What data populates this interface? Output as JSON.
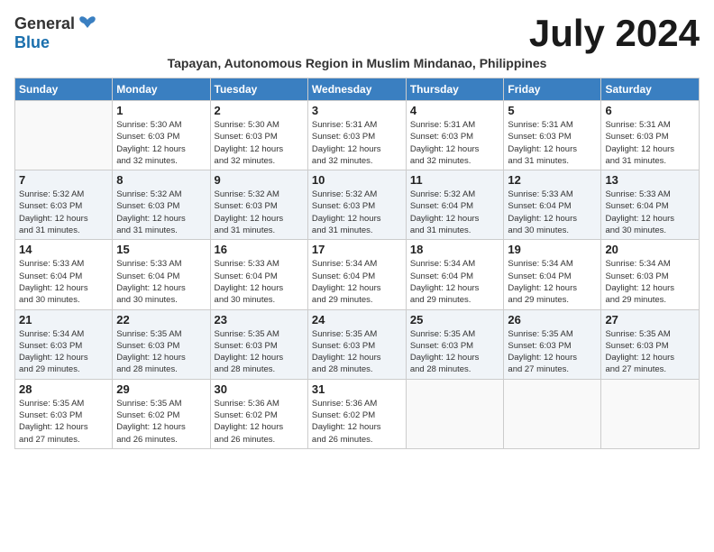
{
  "logo": {
    "general": "General",
    "blue": "Blue"
  },
  "title": "July 2024",
  "subtitle": "Tapayan, Autonomous Region in Muslim Mindanao, Philippines",
  "days_of_week": [
    "Sunday",
    "Monday",
    "Tuesday",
    "Wednesday",
    "Thursday",
    "Friday",
    "Saturday"
  ],
  "weeks": [
    [
      {
        "date": "",
        "info": ""
      },
      {
        "date": "1",
        "info": "Sunrise: 5:30 AM\nSunset: 6:03 PM\nDaylight: 12 hours\nand 32 minutes."
      },
      {
        "date": "2",
        "info": "Sunrise: 5:30 AM\nSunset: 6:03 PM\nDaylight: 12 hours\nand 32 minutes."
      },
      {
        "date": "3",
        "info": "Sunrise: 5:31 AM\nSunset: 6:03 PM\nDaylight: 12 hours\nand 32 minutes."
      },
      {
        "date": "4",
        "info": "Sunrise: 5:31 AM\nSunset: 6:03 PM\nDaylight: 12 hours\nand 32 minutes."
      },
      {
        "date": "5",
        "info": "Sunrise: 5:31 AM\nSunset: 6:03 PM\nDaylight: 12 hours\nand 31 minutes."
      },
      {
        "date": "6",
        "info": "Sunrise: 5:31 AM\nSunset: 6:03 PM\nDaylight: 12 hours\nand 31 minutes."
      }
    ],
    [
      {
        "date": "7",
        "info": "Sunrise: 5:32 AM\nSunset: 6:03 PM\nDaylight: 12 hours\nand 31 minutes."
      },
      {
        "date": "8",
        "info": "Sunrise: 5:32 AM\nSunset: 6:03 PM\nDaylight: 12 hours\nand 31 minutes."
      },
      {
        "date": "9",
        "info": "Sunrise: 5:32 AM\nSunset: 6:03 PM\nDaylight: 12 hours\nand 31 minutes."
      },
      {
        "date": "10",
        "info": "Sunrise: 5:32 AM\nSunset: 6:03 PM\nDaylight: 12 hours\nand 31 minutes."
      },
      {
        "date": "11",
        "info": "Sunrise: 5:32 AM\nSunset: 6:04 PM\nDaylight: 12 hours\nand 31 minutes."
      },
      {
        "date": "12",
        "info": "Sunrise: 5:33 AM\nSunset: 6:04 PM\nDaylight: 12 hours\nand 30 minutes."
      },
      {
        "date": "13",
        "info": "Sunrise: 5:33 AM\nSunset: 6:04 PM\nDaylight: 12 hours\nand 30 minutes."
      }
    ],
    [
      {
        "date": "14",
        "info": "Sunrise: 5:33 AM\nSunset: 6:04 PM\nDaylight: 12 hours\nand 30 minutes."
      },
      {
        "date": "15",
        "info": "Sunrise: 5:33 AM\nSunset: 6:04 PM\nDaylight: 12 hours\nand 30 minutes."
      },
      {
        "date": "16",
        "info": "Sunrise: 5:33 AM\nSunset: 6:04 PM\nDaylight: 12 hours\nand 30 minutes."
      },
      {
        "date": "17",
        "info": "Sunrise: 5:34 AM\nSunset: 6:04 PM\nDaylight: 12 hours\nand 29 minutes."
      },
      {
        "date": "18",
        "info": "Sunrise: 5:34 AM\nSunset: 6:04 PM\nDaylight: 12 hours\nand 29 minutes."
      },
      {
        "date": "19",
        "info": "Sunrise: 5:34 AM\nSunset: 6:04 PM\nDaylight: 12 hours\nand 29 minutes."
      },
      {
        "date": "20",
        "info": "Sunrise: 5:34 AM\nSunset: 6:03 PM\nDaylight: 12 hours\nand 29 minutes."
      }
    ],
    [
      {
        "date": "21",
        "info": "Sunrise: 5:34 AM\nSunset: 6:03 PM\nDaylight: 12 hours\nand 29 minutes."
      },
      {
        "date": "22",
        "info": "Sunrise: 5:35 AM\nSunset: 6:03 PM\nDaylight: 12 hours\nand 28 minutes."
      },
      {
        "date": "23",
        "info": "Sunrise: 5:35 AM\nSunset: 6:03 PM\nDaylight: 12 hours\nand 28 minutes."
      },
      {
        "date": "24",
        "info": "Sunrise: 5:35 AM\nSunset: 6:03 PM\nDaylight: 12 hours\nand 28 minutes."
      },
      {
        "date": "25",
        "info": "Sunrise: 5:35 AM\nSunset: 6:03 PM\nDaylight: 12 hours\nand 28 minutes."
      },
      {
        "date": "26",
        "info": "Sunrise: 5:35 AM\nSunset: 6:03 PM\nDaylight: 12 hours\nand 27 minutes."
      },
      {
        "date": "27",
        "info": "Sunrise: 5:35 AM\nSunset: 6:03 PM\nDaylight: 12 hours\nand 27 minutes."
      }
    ],
    [
      {
        "date": "28",
        "info": "Sunrise: 5:35 AM\nSunset: 6:03 PM\nDaylight: 12 hours\nand 27 minutes."
      },
      {
        "date": "29",
        "info": "Sunrise: 5:35 AM\nSunset: 6:02 PM\nDaylight: 12 hours\nand 26 minutes."
      },
      {
        "date": "30",
        "info": "Sunrise: 5:36 AM\nSunset: 6:02 PM\nDaylight: 12 hours\nand 26 minutes."
      },
      {
        "date": "31",
        "info": "Sunrise: 5:36 AM\nSunset: 6:02 PM\nDaylight: 12 hours\nand 26 minutes."
      },
      {
        "date": "",
        "info": ""
      },
      {
        "date": "",
        "info": ""
      },
      {
        "date": "",
        "info": ""
      }
    ]
  ]
}
